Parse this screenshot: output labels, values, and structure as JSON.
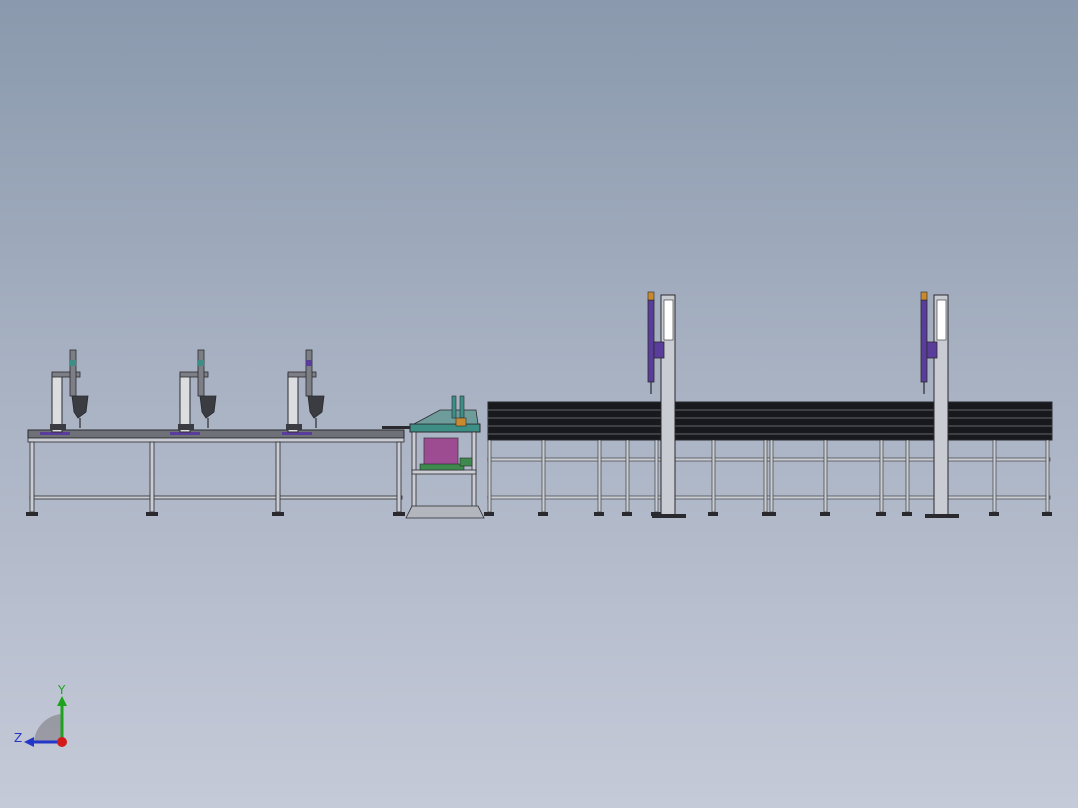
{
  "viewport": {
    "background_top": "#8a99ad",
    "background_bottom": "#c5cad8"
  },
  "colors": {
    "frame": "#7d7f86",
    "frame_dark": "#2a2a2e",
    "frame_light": "#c9ccd2",
    "conveyor_dark": "#18191c",
    "column_light": "#dcdde0",
    "column_white": "#ffffff",
    "accent_purple": "#5a3d9a",
    "accent_magenta": "#9c3a8a",
    "accent_teal": "#3d8f86",
    "accent_green": "#3e8a4e",
    "accent_orange": "#c98a2e",
    "axis_y": "#1fa31f",
    "axis_z": "#2436c8",
    "axis_x": "#d21a1a"
  },
  "triad": {
    "y_label": "Y",
    "z_label": "Z"
  },
  "icons": {
    "triad": "coordinate-triad-icon"
  }
}
